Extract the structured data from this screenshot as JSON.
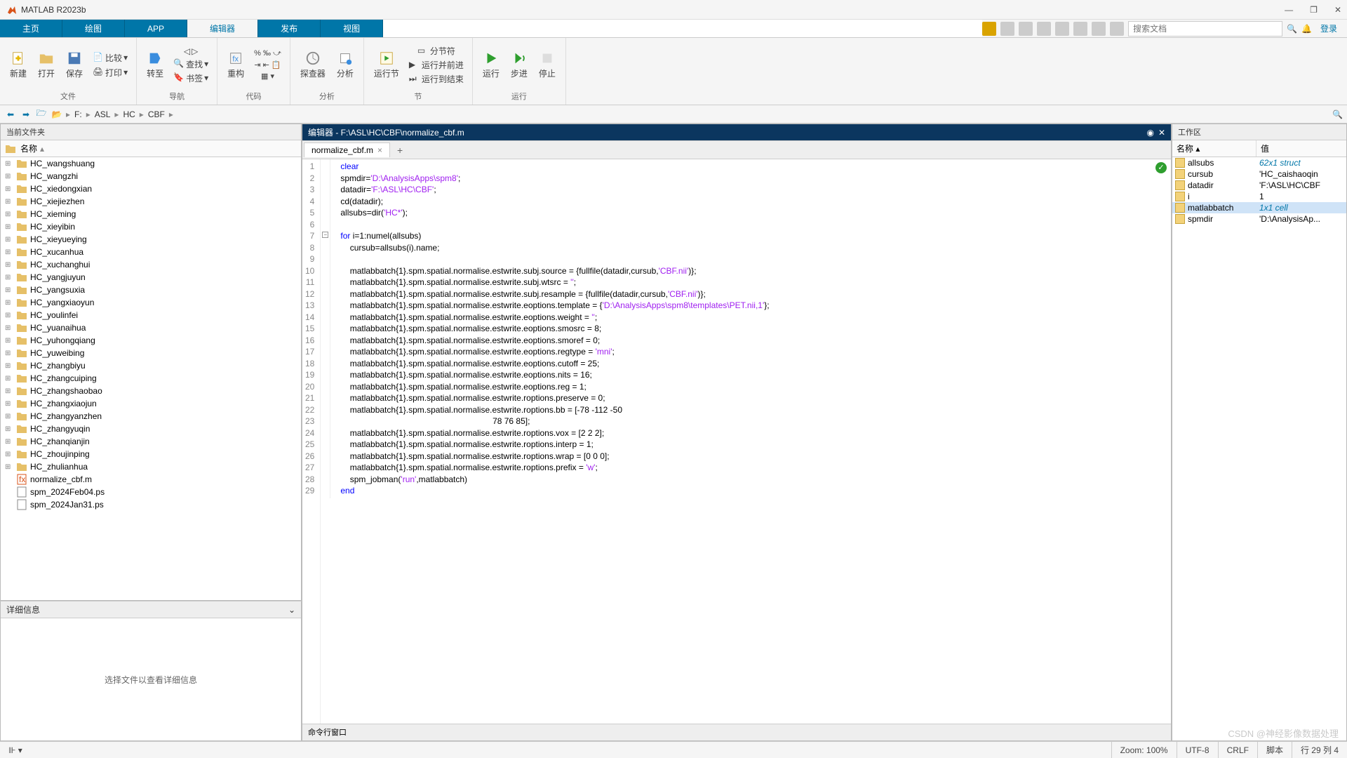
{
  "title": "MATLAB R2023b",
  "tabs": [
    "主页",
    "绘图",
    "APP",
    "编辑器",
    "发布",
    "视图"
  ],
  "active_tab": 3,
  "search_placeholder": "搜索文档",
  "login": "登录",
  "toolstrip": {
    "file": {
      "new": "新建",
      "open": "打开",
      "save": "保存",
      "compare": "比较",
      "print": "打印",
      "label": "文件"
    },
    "nav": {
      "goto": "转至",
      "find": "查找",
      "bookmark": "书签",
      "label": "导航"
    },
    "code": {
      "refactor": "重构",
      "label": "代码"
    },
    "analyze": {
      "inspector": "探查器",
      "analyze": "分析",
      "label": "分析"
    },
    "section": {
      "runsec": "运行节",
      "sec": "分节符",
      "runadv": "运行并前进",
      "runend": "运行到结束",
      "label": "节"
    },
    "run": {
      "run": "运行",
      "step": "步进",
      "stop": "停止",
      "label": "运行"
    }
  },
  "breadcrumb": [
    "F:",
    "ASL",
    "HC",
    "CBF"
  ],
  "current_folder_label": "当前文件夹",
  "name_col": "名称",
  "files": [
    {
      "n": "HC_wangshuang",
      "t": "d"
    },
    {
      "n": "HC_wangzhi",
      "t": "d"
    },
    {
      "n": "HC_xiedongxian",
      "t": "d"
    },
    {
      "n": "HC_xiejiezhen",
      "t": "d"
    },
    {
      "n": "HC_xieming",
      "t": "d"
    },
    {
      "n": "HC_xieyibin",
      "t": "d"
    },
    {
      "n": "HC_xieyueying",
      "t": "d"
    },
    {
      "n": "HC_xucanhua",
      "t": "d"
    },
    {
      "n": "HC_xuchanghui",
      "t": "d"
    },
    {
      "n": "HC_yangjuyun",
      "t": "d"
    },
    {
      "n": "HC_yangsuxia",
      "t": "d"
    },
    {
      "n": "HC_yangxiaoyun",
      "t": "d"
    },
    {
      "n": "HC_youlinfei",
      "t": "d"
    },
    {
      "n": "HC_yuanaihua",
      "t": "d"
    },
    {
      "n": "HC_yuhongqiang",
      "t": "d"
    },
    {
      "n": "HC_yuweibing",
      "t": "d"
    },
    {
      "n": "HC_zhangbiyu",
      "t": "d"
    },
    {
      "n": "HC_zhangcuiping",
      "t": "d"
    },
    {
      "n": "HC_zhangshaobao",
      "t": "d"
    },
    {
      "n": "HC_zhangxiaojun",
      "t": "d"
    },
    {
      "n": "HC_zhangyanzhen",
      "t": "d"
    },
    {
      "n": "HC_zhangyuqin",
      "t": "d"
    },
    {
      "n": "HC_zhanqianjin",
      "t": "d"
    },
    {
      "n": "HC_zhoujinping",
      "t": "d"
    },
    {
      "n": "HC_zhulianhua",
      "t": "d"
    },
    {
      "n": "normalize_cbf.m",
      "t": "m"
    },
    {
      "n": "spm_2024Feb04.ps",
      "t": "f"
    },
    {
      "n": "spm_2024Jan31.ps",
      "t": "f"
    }
  ],
  "details_label": "详细信息",
  "details_msg": "选择文件以查看详细信息",
  "editor_title": "编辑器 - F:\\ASL\\HC\\CBF\\normalize_cbf.m",
  "editor_tab": "normalize_cbf.m",
  "code": [
    {
      "l": 1,
      "t": [
        {
          "c": "kw",
          "s": "clear"
        }
      ]
    },
    {
      "l": 2,
      "t": [
        {
          "s": "spmdir="
        },
        {
          "c": "str",
          "s": "'D:\\AnalysisApps\\spm8'"
        },
        {
          "s": ";"
        }
      ]
    },
    {
      "l": 3,
      "t": [
        {
          "s": "datadir="
        },
        {
          "c": "str",
          "s": "'F:\\ASL\\HC\\CBF'"
        },
        {
          "s": ";"
        }
      ]
    },
    {
      "l": 4,
      "t": [
        {
          "s": "cd(datadir);"
        }
      ]
    },
    {
      "l": 5,
      "t": [
        {
          "s": "allsubs=dir("
        },
        {
          "c": "str",
          "s": "'HC*'"
        },
        {
          "s": ");"
        }
      ]
    },
    {
      "l": 6,
      "t": []
    },
    {
      "l": 7,
      "t": [
        {
          "c": "kw",
          "s": "for"
        },
        {
          "s": " i=1:numel(allsubs)"
        }
      ]
    },
    {
      "l": 8,
      "t": [
        {
          "s": "    cursub=allsubs(i).name;"
        }
      ]
    },
    {
      "l": 9,
      "t": []
    },
    {
      "l": 10,
      "t": [
        {
          "s": "    matlabbatch{1}.spm.spatial.normalise.estwrite.subj.source = {fullfile(datadir,cursub,"
        },
        {
          "c": "str",
          "s": "'CBF.nii'"
        },
        {
          "s": ")};"
        }
      ]
    },
    {
      "l": 11,
      "t": [
        {
          "s": "    matlabbatch{1}.spm.spatial.normalise.estwrite.subj.wtsrc = "
        },
        {
          "c": "str",
          "s": "''"
        },
        {
          "s": ";"
        }
      ]
    },
    {
      "l": 12,
      "t": [
        {
          "s": "    matlabbatch{1}.spm.spatial.normalise.estwrite.subj.resample = {fullfile(datadir,cursub,"
        },
        {
          "c": "str",
          "s": "'CBF.nii'"
        },
        {
          "s": ")};"
        }
      ]
    },
    {
      "l": 13,
      "t": [
        {
          "s": "    matlabbatch{1}.spm.spatial.normalise.estwrite.eoptions.template = {"
        },
        {
          "c": "str",
          "s": "'D:\\AnalysisApps\\spm8\\templates\\PET.nii,1'"
        },
        {
          "s": "};"
        }
      ]
    },
    {
      "l": 14,
      "t": [
        {
          "s": "    matlabbatch{1}.spm.spatial.normalise.estwrite.eoptions.weight = "
        },
        {
          "c": "str",
          "s": "''"
        },
        {
          "s": ";"
        }
      ]
    },
    {
      "l": 15,
      "t": [
        {
          "s": "    matlabbatch{1}.spm.spatial.normalise.estwrite.eoptions.smosrc = 8;"
        }
      ]
    },
    {
      "l": 16,
      "t": [
        {
          "s": "    matlabbatch{1}.spm.spatial.normalise.estwrite.eoptions.smoref = 0;"
        }
      ]
    },
    {
      "l": 17,
      "t": [
        {
          "s": "    matlabbatch{1}.spm.spatial.normalise.estwrite.eoptions.regtype = "
        },
        {
          "c": "str",
          "s": "'mni'"
        },
        {
          "s": ";"
        }
      ]
    },
    {
      "l": 18,
      "t": [
        {
          "s": "    matlabbatch{1}.spm.spatial.normalise.estwrite.eoptions.cutoff = 25;"
        }
      ]
    },
    {
      "l": 19,
      "t": [
        {
          "s": "    matlabbatch{1}.spm.spatial.normalise.estwrite.eoptions.nits = 16;"
        }
      ]
    },
    {
      "l": 20,
      "t": [
        {
          "s": "    matlabbatch{1}.spm.spatial.normalise.estwrite.eoptions.reg = 1;"
        }
      ]
    },
    {
      "l": 21,
      "t": [
        {
          "s": "    matlabbatch{1}.spm.spatial.normalise.estwrite.roptions.preserve = 0;"
        }
      ]
    },
    {
      "l": 22,
      "t": [
        {
          "s": "    matlabbatch{1}.spm.spatial.normalise.estwrite.roptions.bb = [-78 -112 -50"
        }
      ]
    },
    {
      "l": 23,
      "t": [
        {
          "s": "                                                                 78 76 85];"
        }
      ]
    },
    {
      "l": 24,
      "t": [
        {
          "s": "    matlabbatch{1}.spm.spatial.normalise.estwrite.roptions.vox = [2 2 2];"
        }
      ]
    },
    {
      "l": 25,
      "t": [
        {
          "s": "    matlabbatch{1}.spm.spatial.normalise.estwrite.roptions.interp = 1;"
        }
      ]
    },
    {
      "l": 26,
      "t": [
        {
          "s": "    matlabbatch{1}.spm.spatial.normalise.estwrite.roptions.wrap = [0 0 0];"
        }
      ]
    },
    {
      "l": 27,
      "t": [
        {
          "s": "    matlabbatch{1}.spm.spatial.normalise.estwrite.roptions.prefix = "
        },
        {
          "c": "str",
          "s": "'w'"
        },
        {
          "s": ";"
        }
      ]
    },
    {
      "l": 28,
      "t": [
        {
          "s": "    spm_jobman("
        },
        {
          "c": "str",
          "s": "'run'"
        },
        {
          "s": ",matlabbatch)"
        }
      ]
    },
    {
      "l": 29,
      "t": [
        {
          "c": "kw",
          "s": "end"
        }
      ]
    }
  ],
  "cmd_label": "命令行窗口",
  "workspace_label": "工作区",
  "ws_cols": {
    "name": "名称",
    "value": "值"
  },
  "ws": [
    {
      "n": "allsubs",
      "v": "62x1 struct",
      "em": true
    },
    {
      "n": "cursub",
      "v": "'HC_caishaoqin"
    },
    {
      "n": "datadir",
      "v": "'F:\\ASL\\HC\\CBF"
    },
    {
      "n": "i",
      "v": "1"
    },
    {
      "n": "matlabbatch",
      "v": "1x1 cell",
      "em": true,
      "sel": true
    },
    {
      "n": "spmdir",
      "v": "'D:\\AnalysisAp..."
    }
  ],
  "status": {
    "zoom": "Zoom: 100%",
    "enc": "UTF-8",
    "eol": "CRLF",
    "type": "脚本",
    "pos": "行  29   列  4"
  },
  "watermark": "CSDN @神经影像数据处理"
}
